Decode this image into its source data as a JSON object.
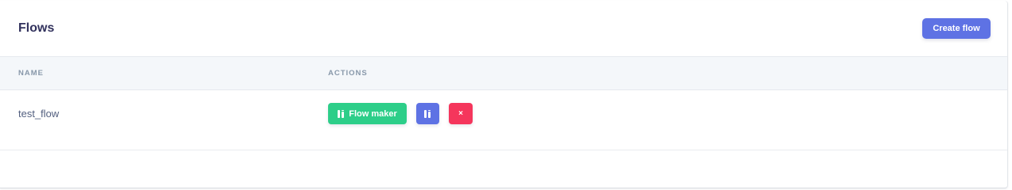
{
  "card": {
    "title": "Flows",
    "create_button_label": "Create flow"
  },
  "table": {
    "columns": [
      "NAME",
      "ACTIONS"
    ],
    "rows": [
      {
        "name": "test_flow",
        "actions": {
          "flow_maker_label": "Flow maker",
          "flow_maker_icon": "columns-icon",
          "view_icon": "columns-icon",
          "delete_icon": "close-icon",
          "delete_glyph": "×"
        }
      }
    ]
  },
  "colors": {
    "primary": "#5e72e4",
    "success": "#2dce89",
    "danger": "#f5365c",
    "heading": "#32325d",
    "header_bg": "#f4f7fa"
  }
}
